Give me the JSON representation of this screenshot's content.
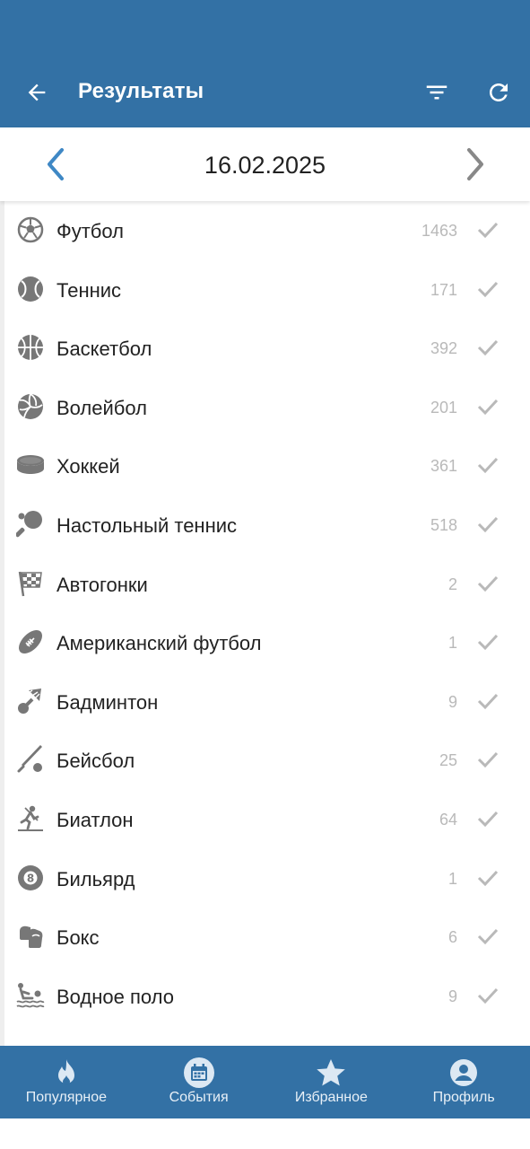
{
  "header": {
    "title": "Результаты",
    "bg_color": "#3371a5"
  },
  "date_nav": {
    "date": "16.02.2025",
    "prev_color": "#3f88c5",
    "next_color": "#888888"
  },
  "sports": [
    {
      "name": "Футбол",
      "count": "1463",
      "icon": "soccer-ball-icon"
    },
    {
      "name": "Теннис",
      "count": "171",
      "icon": "tennis-ball-icon"
    },
    {
      "name": "Баскетбол",
      "count": "392",
      "icon": "basketball-icon"
    },
    {
      "name": "Волейбол",
      "count": "201",
      "icon": "volleyball-icon"
    },
    {
      "name": "Хоккей",
      "count": "361",
      "icon": "hockey-puck-icon"
    },
    {
      "name": "Настольный теннис",
      "count": "518",
      "icon": "table-tennis-icon"
    },
    {
      "name": "Автогонки",
      "count": "2",
      "icon": "checkered-flag-icon"
    },
    {
      "name": "Американский футбол",
      "count": "1",
      "icon": "american-football-icon"
    },
    {
      "name": "Бадминтон",
      "count": "9",
      "icon": "shuttlecock-icon"
    },
    {
      "name": "Бейсбол",
      "count": "25",
      "icon": "baseball-bat-icon"
    },
    {
      "name": "Биатлон",
      "count": "64",
      "icon": "biathlon-icon"
    },
    {
      "name": "Бильярд",
      "count": "1",
      "icon": "billiard-ball-icon"
    },
    {
      "name": "Бокс",
      "count": "6",
      "icon": "boxing-glove-icon"
    },
    {
      "name": "Водное поло",
      "count": "9",
      "icon": "water-polo-icon"
    }
  ],
  "bottom_nav": [
    {
      "label": "Популярное",
      "icon": "fire-icon"
    },
    {
      "label": "События",
      "icon": "calendar-icon"
    },
    {
      "label": "Избранное",
      "icon": "star-icon"
    },
    {
      "label": "Профиль",
      "icon": "account-icon"
    }
  ]
}
